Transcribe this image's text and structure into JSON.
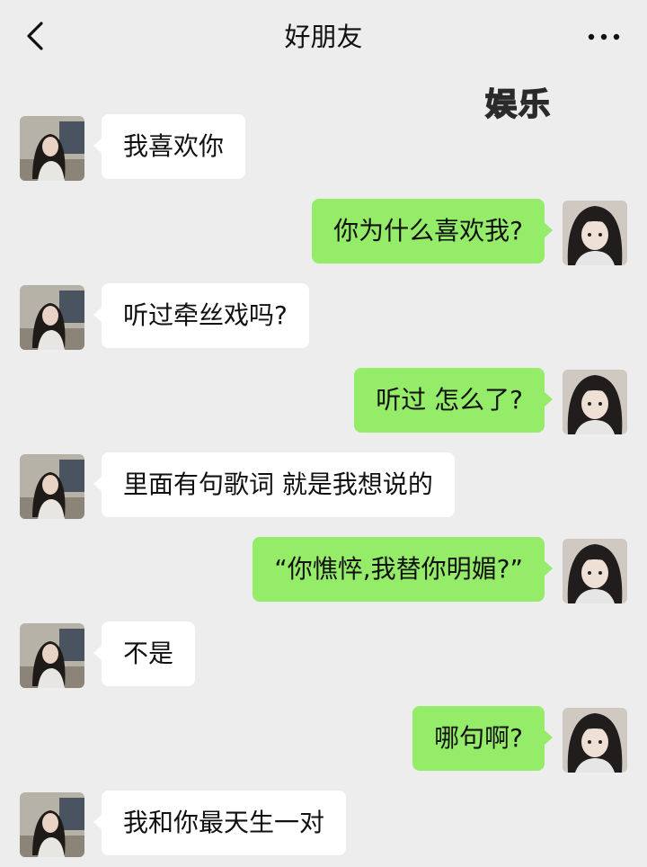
{
  "header": {
    "title": "好朋友",
    "back_icon": "chevron-left-icon",
    "more_icon": "more-dots-icon"
  },
  "watermark": "娱乐",
  "colors": {
    "background": "#ededed",
    "incoming_bubble": "#ffffff",
    "outgoing_bubble": "#95ec69"
  },
  "messages": [
    {
      "side": "left",
      "text": "我喜欢你"
    },
    {
      "side": "right",
      "text": "你为什么喜欢我?"
    },
    {
      "side": "left",
      "text": "听过牵丝戏吗?"
    },
    {
      "side": "right",
      "text": "听过 怎么了?"
    },
    {
      "side": "left",
      "text": "里面有句歌词 就是我想说的"
    },
    {
      "side": "right",
      "text": "“你憔悴,我替你明媚?”"
    },
    {
      "side": "left",
      "text": "不是"
    },
    {
      "side": "right",
      "text": "哪句啊?"
    },
    {
      "side": "left",
      "text": "我和你最天生一对"
    }
  ]
}
